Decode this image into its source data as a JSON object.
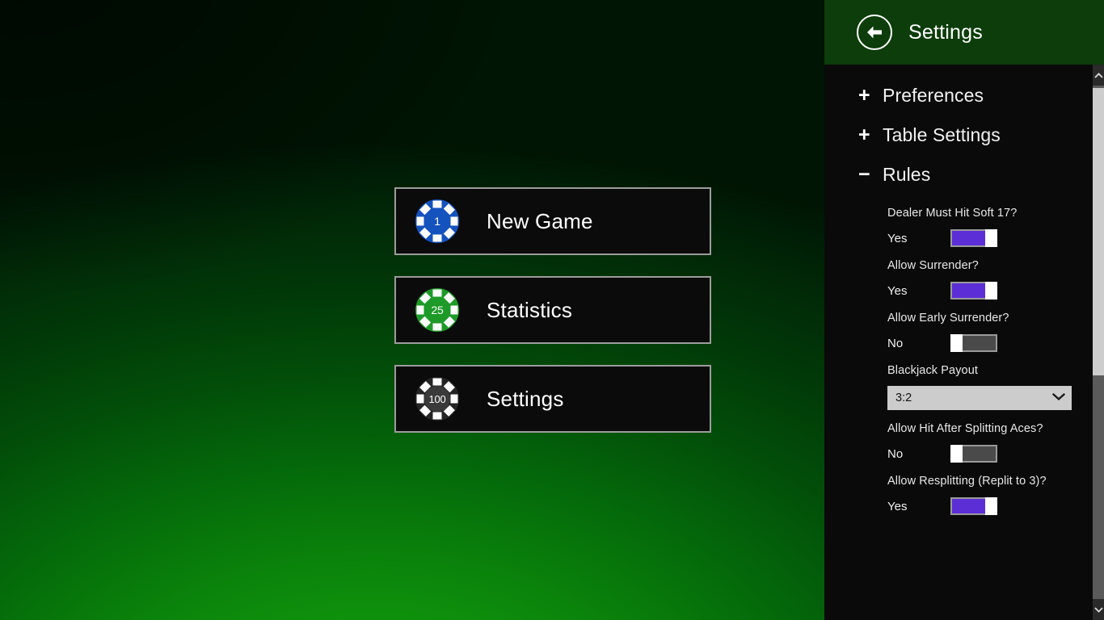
{
  "game": {
    "background_color_bright": "#10950d",
    "background_color_dark": "#001503",
    "menu_buttons": [
      {
        "label": "New Game",
        "chip_value": "1",
        "chip_color": "#1452bd",
        "chip_name": "chip-1"
      },
      {
        "label": "Statistics",
        "chip_value": "25",
        "chip_color": "#1d9a28",
        "chip_name": "chip-25"
      },
      {
        "label": "Settings",
        "chip_value": "100",
        "chip_color": "#3a3a3a",
        "chip_name": "chip-100"
      }
    ]
  },
  "settings": {
    "header": {
      "title": "Settings",
      "back_icon": "back-arrow-icon",
      "background_color": "#0c3d0a"
    },
    "sections": [
      {
        "glyph": "+",
        "label": "Preferences",
        "expanded": false
      },
      {
        "glyph": "+",
        "label": "Table Settings",
        "expanded": false
      },
      {
        "glyph": "−",
        "label": "Rules",
        "expanded": true
      }
    ],
    "rules": [
      {
        "label": "Dealer Must Hit Soft 17?",
        "type": "toggle",
        "state_text": "Yes",
        "on": true
      },
      {
        "label": "Allow Surrender?",
        "type": "toggle",
        "state_text": "Yes",
        "on": true
      },
      {
        "label": "Allow Early Surrender?",
        "type": "toggle",
        "state_text": "No",
        "on": false
      },
      {
        "label": "Blackjack Payout",
        "type": "dropdown",
        "value": "3:2",
        "chevron_icon": "chevron-down-icon"
      },
      {
        "label": "Allow Hit After Splitting Aces?",
        "type": "toggle",
        "state_text": "No",
        "on": false
      },
      {
        "label": "Allow Resplitting (Replit to 3)?",
        "type": "toggle",
        "state_text": "Yes",
        "on": true
      }
    ],
    "toggle_colors": {
      "on": "#5b2ed6",
      "off": "#4a4a4a",
      "thumb": "#ffffff"
    },
    "scrollbar": {
      "up_icon": "chevron-up-icon",
      "down_icon": "chevron-down-icon",
      "thumb_color": "#cdcdcd",
      "track_color": "#5a5a5a"
    }
  }
}
